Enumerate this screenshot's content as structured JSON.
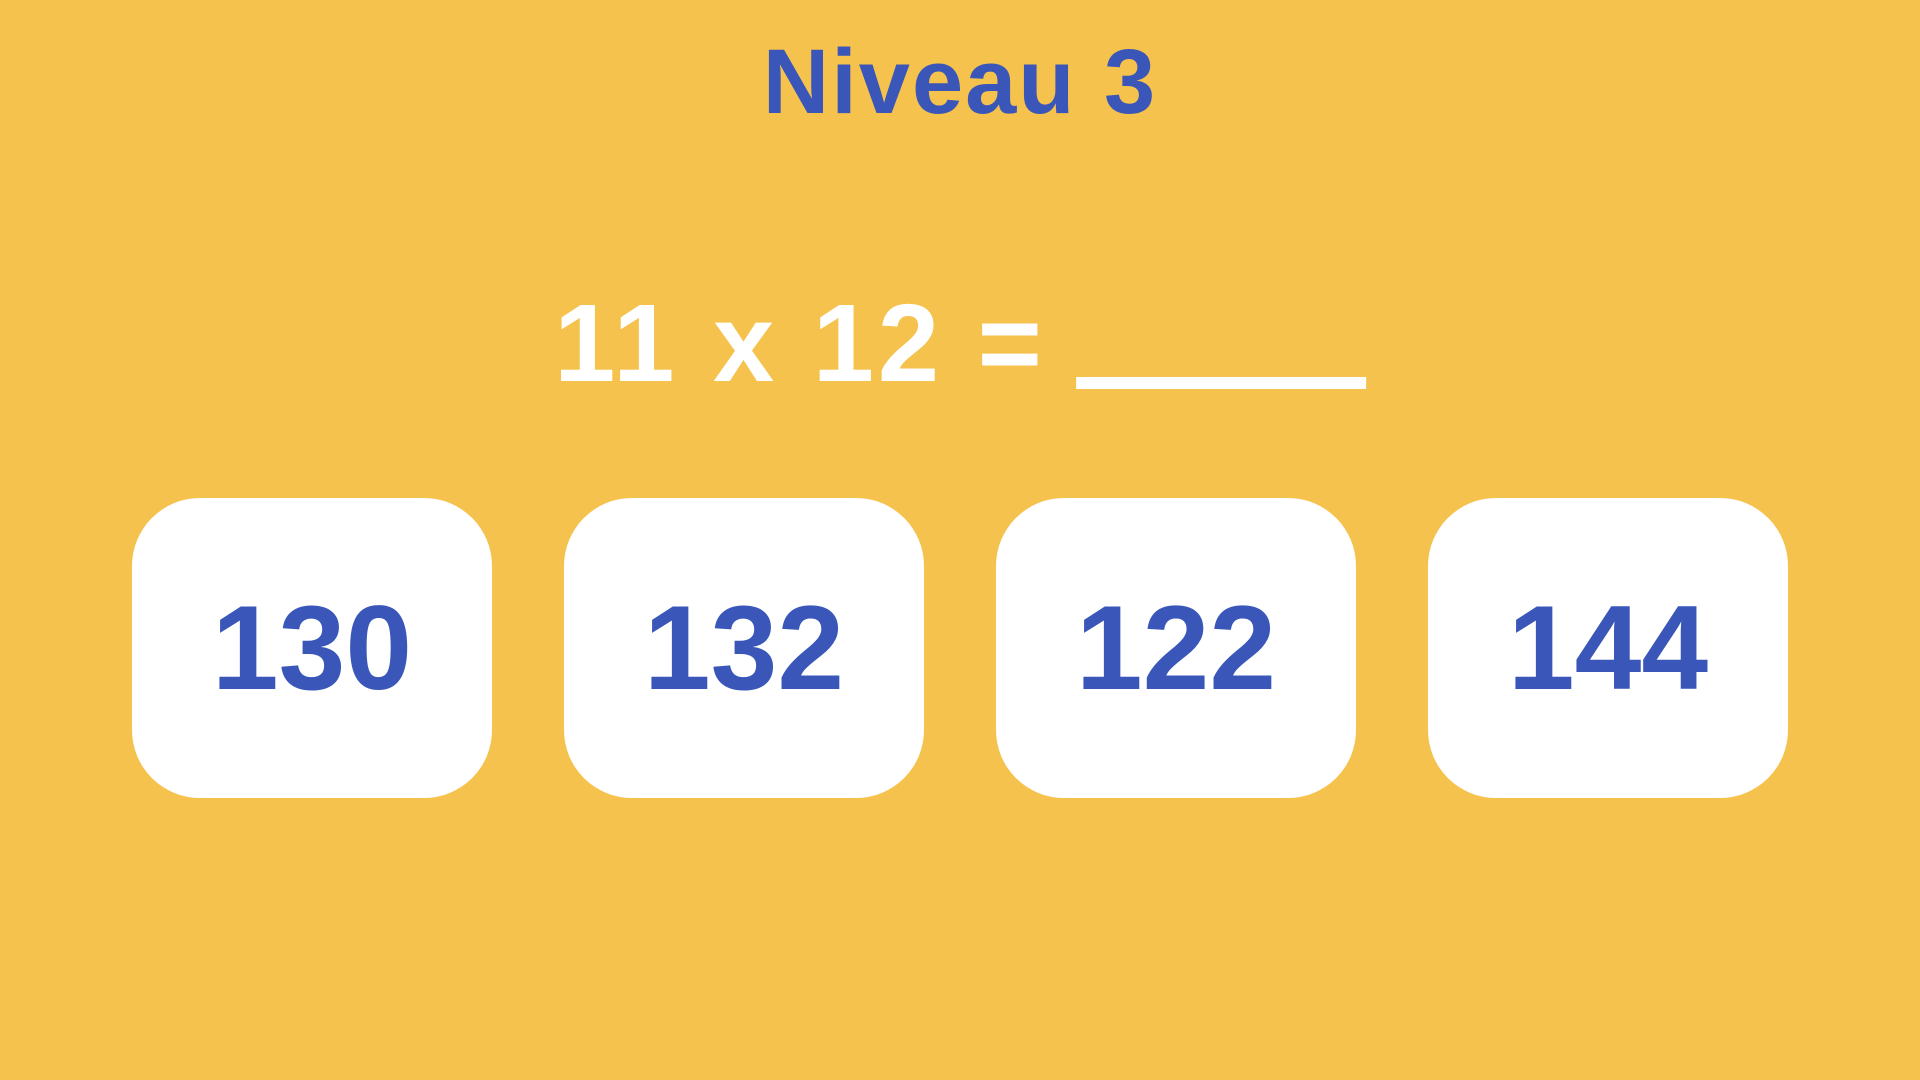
{
  "level": {
    "title": "Niveau 3"
  },
  "question": {
    "expression": "11 x 12 ="
  },
  "options": [
    {
      "value": "130"
    },
    {
      "value": "132"
    },
    {
      "value": "122"
    },
    {
      "value": "144"
    }
  ]
}
